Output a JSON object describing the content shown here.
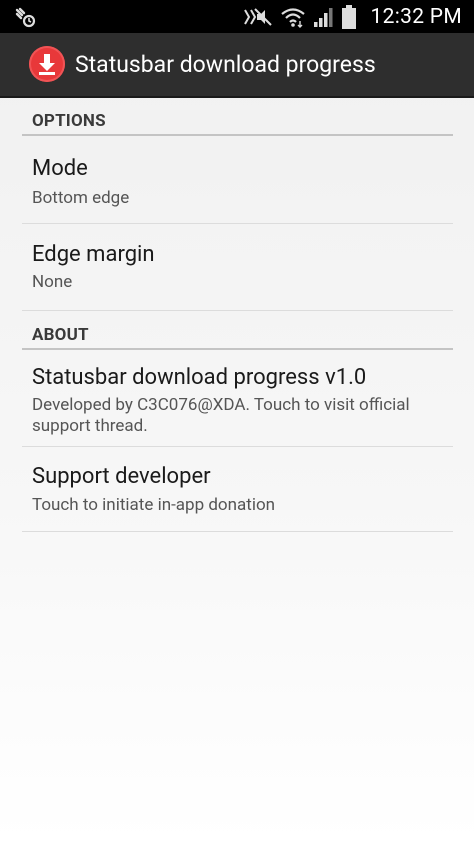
{
  "status_bar": {
    "time": "12:32 PM",
    "icons": [
      "settings-sync-icon",
      "mute-icon",
      "wifi-icon",
      "signal-icon",
      "battery-icon"
    ]
  },
  "action_bar": {
    "title": "Statusbar download progress",
    "app_icon": "download-arrow-icon",
    "colors": {
      "background": "#2e2e2e",
      "app_icon": "#e8383a"
    }
  },
  "sections": [
    {
      "header": "OPTIONS",
      "items": [
        {
          "title": "Mode",
          "summary": "Bottom edge"
        },
        {
          "title": "Edge margin",
          "summary": "None"
        }
      ]
    },
    {
      "header": "ABOUT",
      "items": [
        {
          "title": "Statusbar download progress v1.0",
          "summary": "Developed by C3C076@XDA. Touch to visit official support thread."
        },
        {
          "title": "Support developer",
          "summary": "Touch to initiate in-app donation"
        }
      ]
    }
  ]
}
